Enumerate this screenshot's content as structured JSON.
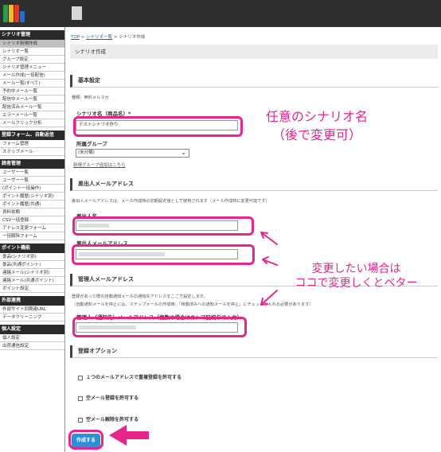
{
  "sidebar": {
    "groups": [
      {
        "heading": "シナリオ管理",
        "items": [
          "シナリオ新規作成",
          "シナリオ一覧",
          "グループ設定",
          "シナリオ管理メニュー",
          "メール作成(一括配信)",
          "メール一覧(すべて)",
          "予約中メール一覧",
          "配信中メール一覧",
          "配信済みメール一覧",
          "エラーメール一覧",
          "メールクリック分析"
        ]
      },
      {
        "heading": "登録フォーム、自動返信",
        "items": [
          "フォーム管理",
          "ステップメール"
        ]
      },
      {
        "heading": "読者管理",
        "items": [
          "ユーザー一覧",
          "ユーザー一覧",
          "(ポイント一括操作)",
          "ポイント履歴(シナリオ別)",
          "ポイント履歴(共通)",
          "資料依頼",
          "CSV一括登録",
          "アドレス変更フォーム",
          "一括解除フォーム"
        ]
      },
      {
        "heading": "ポイント機能",
        "items": [
          "景品(シナリオ別)",
          "景品(共通ポイント)",
          "連絡メール(シナリオ別)",
          "連絡メール(共通ポイント)",
          "ポイント設定"
        ]
      },
      {
        "heading": "外部連携",
        "items": [
          "外部サイト同期連URL",
          "データクリーニング"
        ]
      },
      {
        "heading": "個人設定",
        "items": [
          "個人設定",
          "出荷通信設定"
        ]
      }
    ]
  },
  "breadcrumb": {
    "top": "TOP",
    "list": "シナリオ一覧",
    "current": "シナリオ作成",
    "sep": ">"
  },
  "page": {
    "title": "シナリオ作成"
  },
  "basic": {
    "heading": "基本設定",
    "type_note": "種類：無料メルマガ",
    "name_label": "シナリオ名（商品名）*",
    "name_value": "テストシナリオ作り",
    "group_label": "所属グループ",
    "group_value": "(未分類)",
    "group_link": "新規グループ追加はこちら"
  },
  "sender": {
    "heading": "差出人メールアドレス",
    "note": "差出人メールアドレスは、メール作成時の初期設定値として使用されます（メール作成時に変更可能です）",
    "name_label": "差出人名",
    "email_label": "差出人メールアドレス"
  },
  "manager": {
    "heading": "管理人メールアドレス",
    "note1": "登録があった際の自動通知メールの通知先アドレスをここで設定します。",
    "note2": "（自動通知メールを停止には、ステップメールの作成時、「稼働済みへの通知メールを停止」にチェックを入れる必要があります）",
    "email_label": "管理人（通知先）メールアドレス（複数の場合はカンマ区切りで入力）"
  },
  "options": {
    "heading": "登録オプション",
    "items": [
      "１つのメールアドレスで重複登録を許可する",
      "空メール登録を許可する",
      "空メール解除を許可する"
    ]
  },
  "submit_label": "作成する",
  "annotations": {
    "top_line1": "任意のシナリオ名",
    "top_line2": "（後で変更可）",
    "mid_line1": "変更したい場合は",
    "mid_line2": "ココで変更しくとベター"
  },
  "colors": {
    "accent": "#e6268a",
    "button": "#2d8fd6",
    "topbar": "#2f2f2f"
  }
}
